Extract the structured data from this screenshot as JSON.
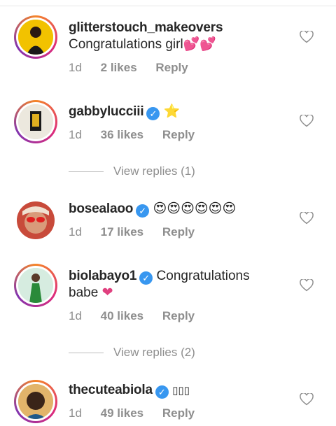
{
  "comments": [
    {
      "username": "glitterstouch_makeovers",
      "verified": false,
      "text": "Congratulations girl",
      "trailing_emoji": "💕💕",
      "time": "1d",
      "likes": "2 likes",
      "reply": "Reply"
    },
    {
      "username": "gabbylucciii",
      "verified": true,
      "text": "",
      "trailing_emoji": "⭐",
      "time": "1d",
      "likes": "36 likes",
      "reply": "Reply",
      "view_replies": "View replies (1)"
    },
    {
      "username": "bosealaoo",
      "verified": true,
      "text": "",
      "trailing_emoji": "😍😍😍😍😍😍",
      "time": "1d",
      "likes": "17 likes",
      "reply": "Reply"
    },
    {
      "username": "biolabayo1",
      "verified": true,
      "text": "Congratulations",
      "text_line2": "babe",
      "trailing_emoji": "❤",
      "time": "1d",
      "likes": "40 likes",
      "reply": "Reply",
      "view_replies": "View replies (2)"
    },
    {
      "username": "thecuteabiola",
      "verified": true,
      "text": "",
      "trailing_emoji": "▯▯▯",
      "time": "1d",
      "likes": "49 likes",
      "reply": "Reply"
    }
  ],
  "colors": {
    "verified": "#3897f0",
    "muted": "#8e8e8e",
    "text": "#262626"
  },
  "icons": {
    "like": "heart-outline-icon",
    "verified": "verified-badge-icon"
  }
}
